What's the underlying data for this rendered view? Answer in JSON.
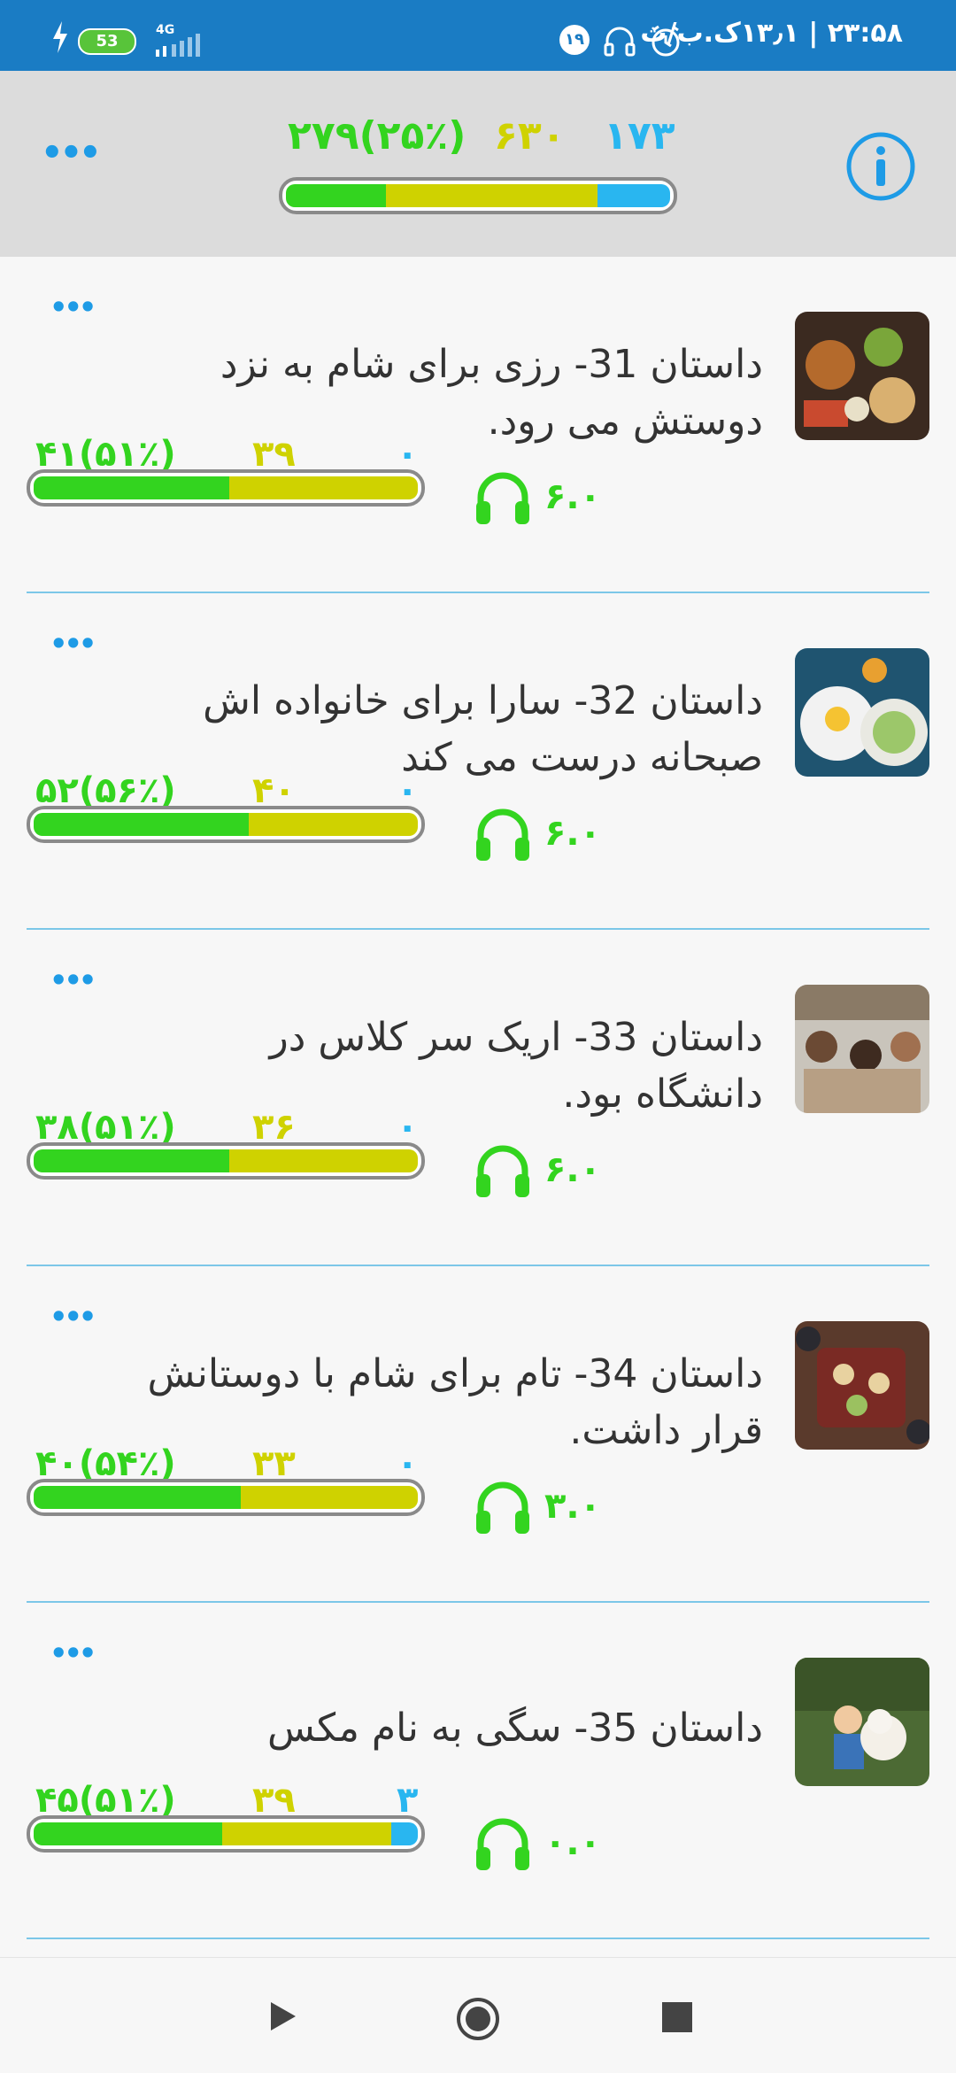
{
  "status_bar": {
    "time": "۲۳:۵۸ | ۱۳٫۱ک.ب/ث",
    "notif_count": "۱۹",
    "battery": "53",
    "network": "4G"
  },
  "header": {
    "stat_known": "۲۷۹(۲۵٪)",
    "stat_learning": "۶۳۰",
    "stat_new": "۱۷۳",
    "progress": {
      "green": 0.26,
      "yellow": 0.55,
      "blue": 0.19
    }
  },
  "stories": [
    {
      "title": "داستان 31- رزی برای شام به نزد دوستش می رود.",
      "known": "۴۱(۵۱٪)",
      "learning": "۳۹",
      "new": "۰",
      "duration": "۶.۰",
      "progress": {
        "green": 0.51,
        "yellow": 0.49,
        "blue": 0
      }
    },
    {
      "title": "داستان 32- سارا برای خانواده اش صبحانه درست می کند",
      "known": "۵۲(۵۶٪)",
      "learning": "۴۰",
      "new": "۰",
      "duration": "۶.۰",
      "progress": {
        "green": 0.56,
        "yellow": 0.44,
        "blue": 0
      }
    },
    {
      "title": "داستان 33- اریک سر کلاس در دانشگاه بود.",
      "known": "۳۸(۵۱٪)",
      "learning": "۳۶",
      "new": "۰",
      "duration": "۶.۰",
      "progress": {
        "green": 0.51,
        "yellow": 0.49,
        "blue": 0
      }
    },
    {
      "title": "داستان 34- تام برای شام با دوستانش قرار داشت.",
      "known": "۴۰(۵۴٪)",
      "learning": "۳۳",
      "new": "۰",
      "duration": "۳.۰",
      "progress": {
        "green": 0.54,
        "yellow": 0.46,
        "blue": 0
      }
    },
    {
      "title": "داستان 35- سگی به نام مکس",
      "known": "۴۵(۵۱٪)",
      "learning": "۳۹",
      "new": "۳",
      "duration": "۰.۰",
      "progress": {
        "green": 0.49,
        "yellow": 0.44,
        "blue": 0.07
      }
    }
  ],
  "colors": {
    "green": "#33d41f",
    "yellow": "#cfd200",
    "blue": "#29b6f0",
    "accent": "#1a7cc4"
  }
}
